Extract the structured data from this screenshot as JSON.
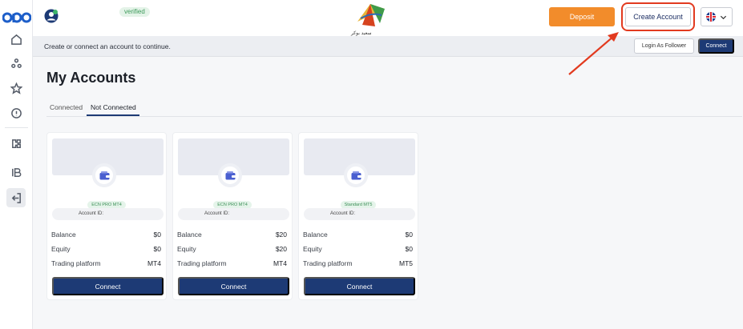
{
  "app": {
    "logo_text": "opo"
  },
  "header": {
    "verified_badge": "verified",
    "brand_text": "سعيد بوكر",
    "deposit_label": "Deposit",
    "create_account_label": "Create Account"
  },
  "subbar": {
    "message": "Create or connect an account to continue.",
    "login_follower_label": "Login As Follower",
    "connect_label": "Connect"
  },
  "page": {
    "title": "My Accounts",
    "tabs": [
      {
        "label": "Connected",
        "active": false
      },
      {
        "label": "Not Connected",
        "active": true
      }
    ]
  },
  "labels": {
    "account_id": "Account ID:",
    "balance": "Balance",
    "equity": "Equity",
    "trading_platform": "Trading platform",
    "connect": "Connect"
  },
  "accounts": [
    {
      "type": "ECN PRO MT4",
      "balance": "$0",
      "equity": "$0",
      "platform": "MT4"
    },
    {
      "type": "ECN PRO MT4",
      "balance": "$20",
      "equity": "$20",
      "platform": "MT4"
    },
    {
      "type": "Standard MT5",
      "balance": "$0",
      "equity": "$0",
      "platform": "MT5"
    }
  ],
  "colors": {
    "accent": "#1d3a75",
    "deposit": "#f28c2b",
    "highlight": "#e23a1f",
    "verified": "#3c9a5a"
  },
  "icons": [
    "home-icon",
    "users-icon",
    "star-icon",
    "help-icon",
    "puzzle-icon",
    "ib-icon",
    "logout-icon",
    "user-icon",
    "wallet-icon",
    "flag-uk-icon",
    "chevron-down-icon"
  ]
}
